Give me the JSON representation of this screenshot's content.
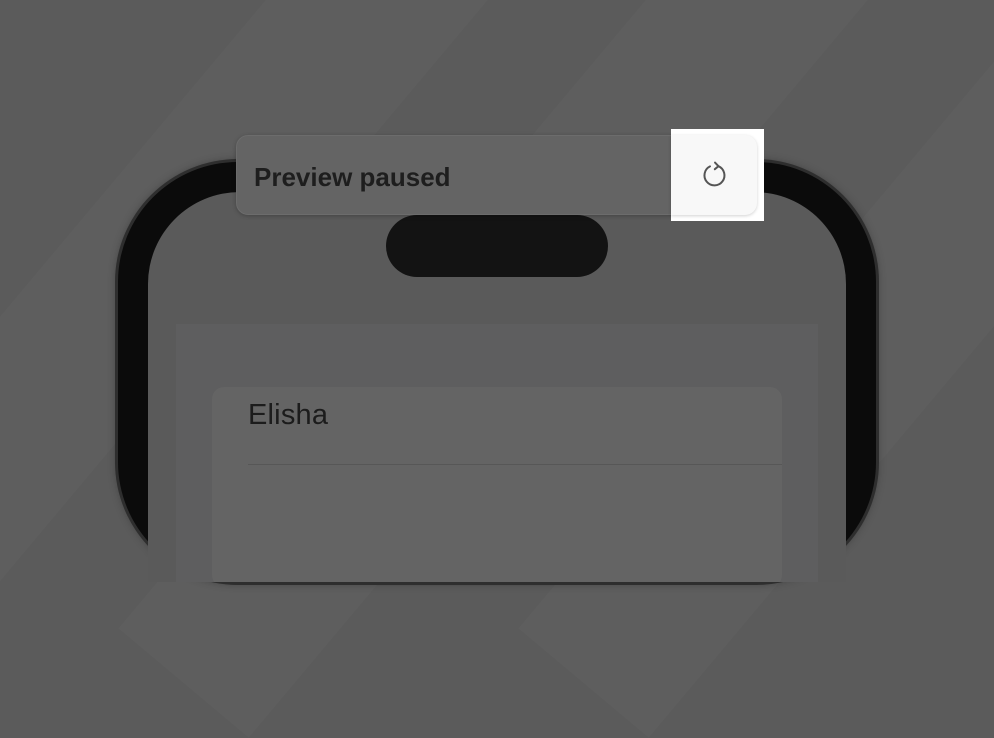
{
  "preview": {
    "status_text": "Preview paused",
    "refresh_icon": "refresh-icon"
  },
  "app": {
    "list": [
      {
        "label": "Elisha"
      }
    ]
  },
  "colors": {
    "backdrop": "#5b5b5b",
    "phone_frame": "#0b0b0b",
    "highlight": "#ffffff"
  }
}
